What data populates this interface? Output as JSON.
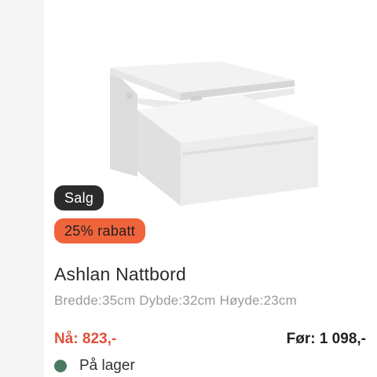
{
  "product": {
    "name": "Ashlan Nattbord",
    "dimensions": "Bredde:35cm Dybde:32cm Høyde:23cm",
    "badges": {
      "sale": "Salg",
      "discount": "25% rabatt"
    },
    "price": {
      "now_label": "Nå: 823,-",
      "before_label": "Før:  1 098,-"
    },
    "stock": {
      "label": "På lager",
      "status_color": "#4a7a62"
    }
  },
  "colors": {
    "sale_badge_bg": "#2b2b2b",
    "discount_badge_bg": "#f0643c",
    "price_now": "#e0513b"
  }
}
